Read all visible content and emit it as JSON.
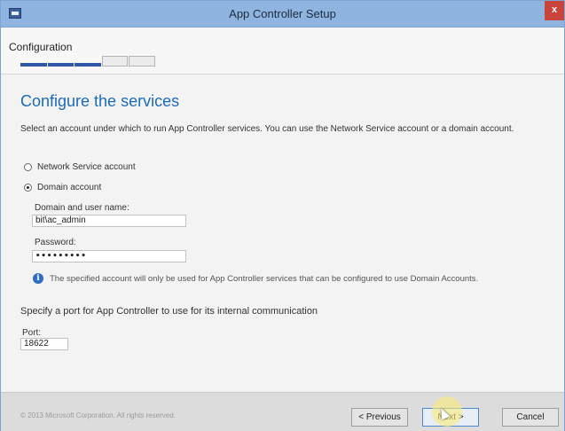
{
  "window": {
    "title": "App Controller Setup",
    "close_glyph": "x",
    "app_icon": "window-app-icon",
    "colors": {
      "titlebar": "#8fb4e0",
      "accent": "#1c6ab8",
      "progress": "#2e57a8"
    }
  },
  "header": {
    "step_label": "Configuration",
    "progress": {
      "completed_steps": 3,
      "total_steps": 5
    }
  },
  "main": {
    "heading": "Configure the services",
    "description": "Select an account under which to run App Controller services. You can use the Network Service account or a domain account.",
    "options": [
      {
        "label": "Network Service account",
        "selected": false
      },
      {
        "label": "Domain account",
        "selected": true
      }
    ],
    "domain_user_label": "Domain and user name:",
    "domain_user_value": "bit\\ac_admin",
    "password_label": "Password:",
    "password_value": "•••••••••",
    "info_text": "The specified account will only be used for App Controller services that can be configured to use Domain Accounts.",
    "info_icon": "info-icon",
    "port_heading": "Specify a port for App Controller to use for its internal communication",
    "port_label": "Port:",
    "port_value": "18622"
  },
  "footer": {
    "copyright": "© 2013 Microsoft Corporation. All rights reserved.",
    "previous_label": "< Previous",
    "next_label": "Next >",
    "cancel_label": "Cancel"
  }
}
